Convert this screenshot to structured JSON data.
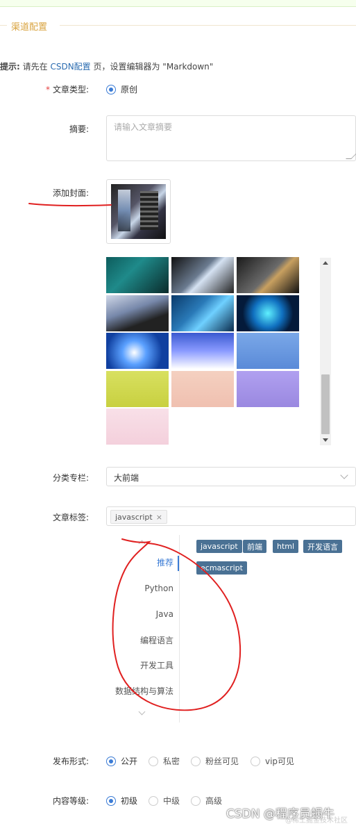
{
  "section": {
    "title": "渠道配置"
  },
  "tip": {
    "prefix": "提示:",
    "before": " 请先在 ",
    "link": "CSDN配置",
    "after": " 页，设置编辑器为 \"Markdown\""
  },
  "article_type": {
    "label": "文章类型:",
    "required_mark": "*",
    "option": "原创"
  },
  "summary": {
    "label": "摘要:",
    "placeholder": "请输入文章摘要"
  },
  "cover": {
    "label": "添加封面:"
  },
  "gallery": {
    "thumbs": [
      {
        "name": "cover-thumb-1"
      },
      {
        "name": "cover-thumb-2"
      },
      {
        "name": "cover-thumb-3"
      },
      {
        "name": "cover-thumb-4"
      },
      {
        "name": "cover-thumb-5"
      },
      {
        "name": "cover-thumb-6"
      },
      {
        "name": "cover-thumb-7"
      },
      {
        "name": "cover-thumb-8"
      },
      {
        "name": "cover-thumb-9"
      },
      {
        "name": "cover-thumb-10"
      },
      {
        "name": "cover-thumb-11"
      },
      {
        "name": "cover-thumb-12"
      },
      {
        "name": "cover-thumb-13"
      }
    ],
    "scroll_fraction": 0.62
  },
  "category": {
    "label": "分类专栏:",
    "value": "大前端"
  },
  "tags": {
    "label": "文章标签:",
    "selected": "javascript",
    "remove": "×"
  },
  "tag_categories": [
    "推荐",
    "Python",
    "Java",
    "编程语言",
    "开发工具",
    "数据结构与算法"
  ],
  "suggested_tags": [
    "javascript",
    "前端",
    "html",
    "开发语言",
    "ecmascript"
  ],
  "publish": {
    "label": "发布形式:",
    "options": [
      "公开",
      "私密",
      "粉丝可见",
      "vip可见"
    ],
    "selected": "公开"
  },
  "level": {
    "label": "内容等级:",
    "options": [
      "初级",
      "中级",
      "高级"
    ],
    "selected": "初级"
  },
  "watermark": {
    "main": "CSDN @程序员蜗牛",
    "sub": "@稀土掘金技术社区"
  },
  "colors": {
    "accent": "#3a7bd5",
    "section_title": "#d9a441",
    "chip_bg": "#4a7194",
    "annotation": "#e02020"
  }
}
